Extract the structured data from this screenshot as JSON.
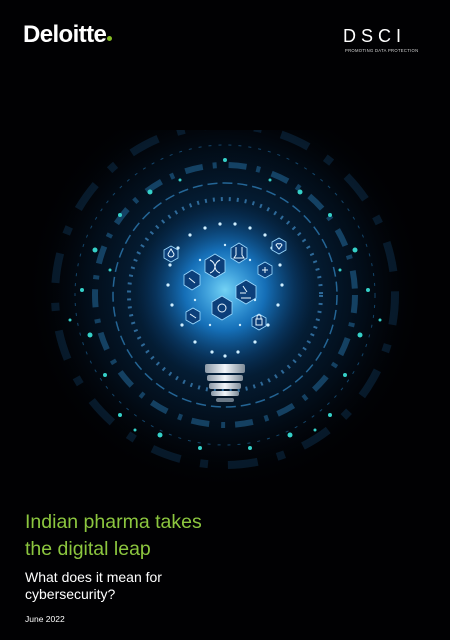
{
  "branding": {
    "deloitte_wordmark": "Deloitte",
    "dsci_wordmark": "DSCI",
    "dsci_tagline": "PROMOTING DATA PROTECTION",
    "deloitte_dot_color": "#86bc25"
  },
  "cover": {
    "title": "Indian pharma takes\nthe digital leap",
    "subtitle": "What does it mean for\ncybersecurity?",
    "date": "June 2022"
  },
  "artwork": {
    "description_icons": [
      "dna-icon",
      "flask-icon",
      "microscope-icon",
      "pill-icon",
      "syringe-icon",
      "lock-icon",
      "heart-icon",
      "magnifier-icon",
      "drop-icon",
      "cross-icon"
    ],
    "glow_color": "#1aa3ff",
    "dot_color": "#35d0c8"
  },
  "colors": {
    "title": "#8cc63f",
    "background": "#010103",
    "text": "#ffffff"
  }
}
